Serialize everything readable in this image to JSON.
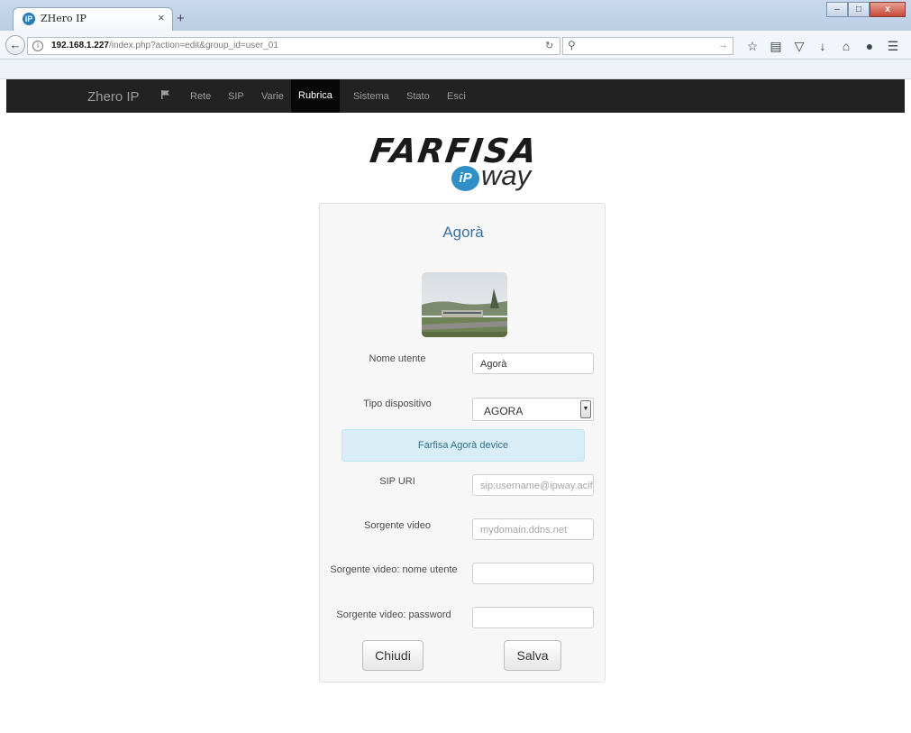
{
  "browser": {
    "tab_title": "ZHero IP",
    "tab_close": "×",
    "new_tab": "+",
    "favicon": "iP",
    "url_host": "192.168.1.227",
    "url_path": "/index.php?action=edit&group_id=user_01",
    "window_buttons": [
      "–",
      "□",
      "x"
    ]
  },
  "navbar": {
    "brand": "Zhero IP",
    "items": [
      "Rete",
      "SIP",
      "Varie",
      "Rubrica",
      "Sistema",
      "Stato",
      "Esci"
    ],
    "active_item": "Rubrica",
    "icons": [
      "flag-icon"
    ]
  },
  "logo": {
    "brand": "FARFISA",
    "ip": "iP",
    "way": "way",
    "colors": {
      "ip_circle": "#2f8fc6"
    }
  },
  "form": {
    "title": "Agorà",
    "fields": {
      "nome_utente": {
        "label": "Nome utente",
        "value": "Agorà"
      },
      "tipo_dispositivo": {
        "label": "Tipo dispositivo",
        "value": "AGORA"
      },
      "info": "Farfisa Agorà device",
      "sip_uri": {
        "label": "SIP URI",
        "placeholder": "sip:username@ipway.acif"
      },
      "sorgente_video": {
        "label": "Sorgente video",
        "placeholder": "mydomain.ddns.net"
      },
      "sv_nome_utente": {
        "label": "Sorgente video: nome utente",
        "value": ""
      },
      "sv_password": {
        "label": "Sorgente video: password",
        "value": ""
      }
    },
    "buttons": {
      "close": "Chiudi",
      "save": "Salva"
    }
  },
  "colors": {
    "navbar_bg": "#222222",
    "navbar_active_bg": "#080808",
    "title_blue": "#3a72a5",
    "info_bg": "#d9edf7"
  }
}
